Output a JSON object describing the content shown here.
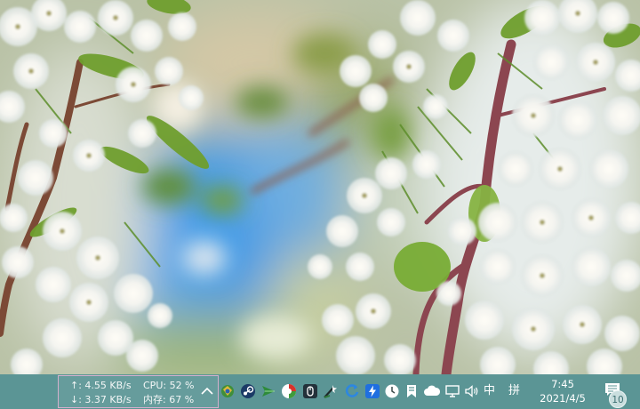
{
  "netmon": {
    "upload": "↑: 4.55 KB/s",
    "download": "↓: 3.37 KB/s",
    "cpu": "CPU: 52 %",
    "memory": "内存: 67 %"
  },
  "tray_icons": [
    "chevron-up-icon",
    "globe-app-icon",
    "steam-icon",
    "paper-plane-icon",
    "antivirus-icon",
    "mouse-icon",
    "wand-app-icon",
    "refresh-arrow-icon",
    "lightning-icon",
    "clock-icon",
    "bookmark-icon",
    "cloud-icon",
    "network-icon",
    "volume-icon"
  ],
  "ime": {
    "language": "中",
    "mode": "拼"
  },
  "clock": {
    "time": "7:45",
    "date": "2021/4/5"
  },
  "notifications": {
    "count": "10"
  },
  "colors": {
    "taskbar": "#5b9595",
    "netmon_border": "#d3b0cd",
    "sky": "#4a9ee0"
  }
}
